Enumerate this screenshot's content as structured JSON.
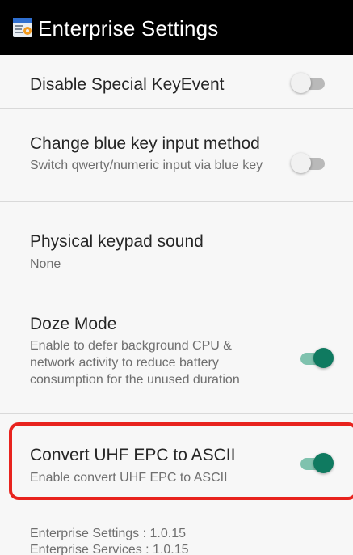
{
  "appbar": {
    "title": "Enterprise Settings",
    "icon": "settings-app-icon"
  },
  "items": [
    {
      "title": "Disable Special KeyEvent",
      "summary": "",
      "enabled": false
    },
    {
      "title": "Change blue key input method",
      "summary": "Switch qwerty/numeric input via blue key",
      "enabled": false
    },
    {
      "title": "Physical keypad sound",
      "summary": "None"
    },
    {
      "title": "Doze Mode",
      "summary": "Enable to defer background CPU & network activity to reduce battery consumption for the unused duration",
      "enabled": true
    },
    {
      "title": "Convert UHF EPC to ASCII",
      "summary": "Enable convert UHF EPC to ASCII",
      "enabled": true
    }
  ],
  "footer": {
    "settings_version": "Enterprise Settings : 1.0.15",
    "services_version": "Enterprise Services : 1.0.15"
  },
  "colors": {
    "accent": "#0f7a60",
    "highlight": "#e8231e",
    "appbar": "#000000"
  }
}
